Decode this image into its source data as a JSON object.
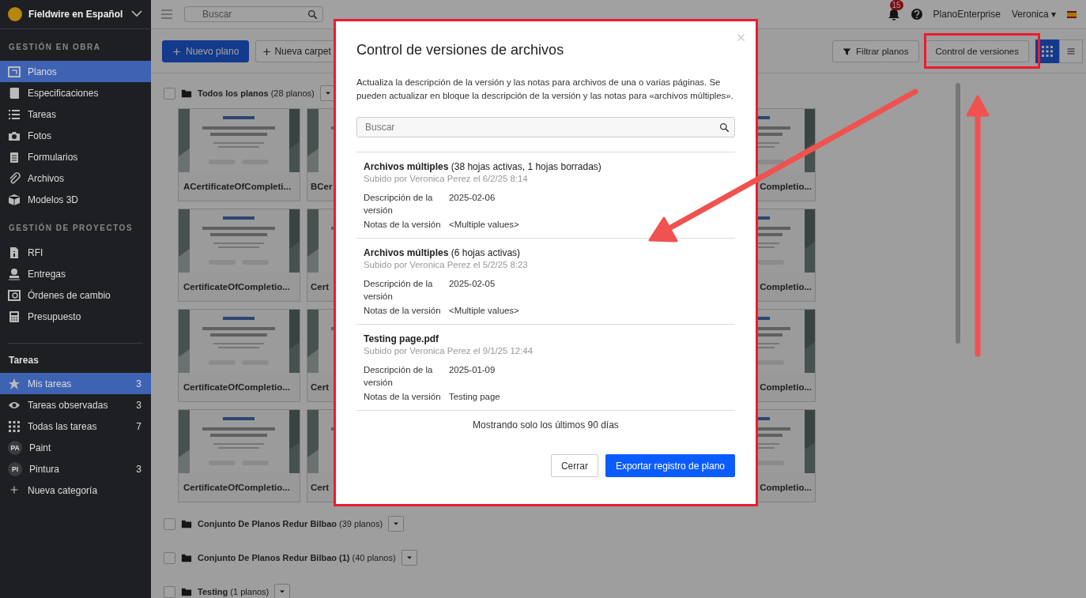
{
  "sidebar": {
    "project": "Fieldwire en Español",
    "sections": [
      {
        "title": "GESTIÓN EN OBRA",
        "items": [
          {
            "label": "Planos",
            "selected": true
          },
          {
            "label": "Especificaciones",
            "selected": false
          },
          {
            "label": "Tareas",
            "selected": false
          },
          {
            "label": "Fotos",
            "selected": false
          },
          {
            "label": "Formularios",
            "selected": false
          },
          {
            "label": "Archivos",
            "selected": false
          },
          {
            "label": "Modelos 3D",
            "selected": false
          }
        ]
      },
      {
        "title": "GESTIÓN DE PROYECTOS",
        "items": [
          {
            "label": "RFI",
            "selected": false
          },
          {
            "label": "Entregas",
            "selected": false
          },
          {
            "label": "Órdenes de cambio",
            "selected": false
          },
          {
            "label": "Presupuesto",
            "selected": false
          }
        ]
      }
    ],
    "tasks": {
      "title": "Tareas",
      "items": [
        {
          "kind": "icon",
          "label": "Mis tareas",
          "count": "3",
          "selected": true
        },
        {
          "kind": "icon",
          "label": "Tareas observadas",
          "count": "3",
          "selected": false
        },
        {
          "kind": "icon",
          "label": "Todas las tareas",
          "count": "7",
          "selected": false
        },
        {
          "kind": "avatar",
          "avatar": "PA",
          "label": "Paint",
          "selected": false
        },
        {
          "kind": "avatar",
          "avatar": "PI",
          "label": "Pintura",
          "count": "3",
          "selected": false
        },
        {
          "kind": "add",
          "label": "Nueva categoría",
          "selected": false
        }
      ]
    }
  },
  "topbar": {
    "search": {
      "placeholder": "Buscar"
    },
    "notifications": "15",
    "links": [
      "PlanoEnterprise",
      "Veronica"
    ],
    "user_caret": "▾"
  },
  "toolbar": {
    "left": [
      "Nuevo plano",
      "Nueva carpet"
    ],
    "right": [
      "Filtrar planos",
      "Control de versiones"
    ],
    "views": [
      {
        "kind": "grid",
        "selected": true
      },
      {
        "kind": "list",
        "selected": false
      }
    ]
  },
  "main_folder": {
    "name": "Todos los planos",
    "count": "(28 planos)",
    "checked": false,
    "card_rows": [
      [
        "ACertificateOfCompleti...",
        "BCer",
        "Completio..."
      ],
      [
        "CertificateOfCompletio...",
        "Cert",
        "Completio..."
      ],
      [
        "CertificateOfCompletio...",
        "Cert",
        "Completio..."
      ],
      [
        "CertificateOfCompletio...",
        "Cert",
        "Completio..."
      ]
    ]
  },
  "folders": [
    {
      "name": "Conjunto De Planos Redur Bilbao",
      "count": "(39 planos)",
      "checked": false
    },
    {
      "name": "Conjunto De Planos Redur Bilbao (1)",
      "count": "(40 planos)",
      "checked": false
    },
    {
      "name": "Testing",
      "count": "(1 planos)",
      "checked": false
    }
  ],
  "modal": {
    "title": "Control de versiones de archivos",
    "description": "Actualiza la descripción de la versión y las notas para archivos de una o varias páginas. Se pueden actualizar en bloque la descripción de la versión y las notas para «archivos múltiples».",
    "search": {
      "placeholder": "Buscar"
    },
    "entries": [
      {
        "name": "Archivos múltiples",
        "detail": "(38 hojas activas, 1 hojas borradas)",
        "uploaded": "Subido por Veronica Perez el 6/2/25 8:14",
        "fields": [
          {
            "label": "Descripción de la versión",
            "value": "2025-02-06"
          },
          {
            "label": "Notas de la versión",
            "value": "<Multiple values>"
          }
        ]
      },
      {
        "name": "Archivos múltiples",
        "detail": "(6 hojas activas)",
        "uploaded": "Subido por Veronica Perez el 5/2/25 8:23",
        "fields": [
          {
            "label": "Descripción de la versión",
            "value": "2025-02-05"
          },
          {
            "label": "Notas de la versión",
            "value": "<Multiple values>"
          }
        ]
      },
      {
        "name": "Testing page.pdf",
        "uploaded": "Subido por Veronica Perez el 9/1/25 12:44",
        "fields": [
          {
            "label": "Descripción de la versión",
            "value": "2025-01-09"
          },
          {
            "label": "Notas de la versión",
            "value": "Testing page"
          }
        ]
      }
    ],
    "note": "Mostrando solo los últimos 90 días",
    "buttons": [
      {
        "kind": "secondary",
        "label": "Cerrar"
      },
      {
        "kind": "primary",
        "label": "Exportar registro de plano"
      }
    ]
  }
}
